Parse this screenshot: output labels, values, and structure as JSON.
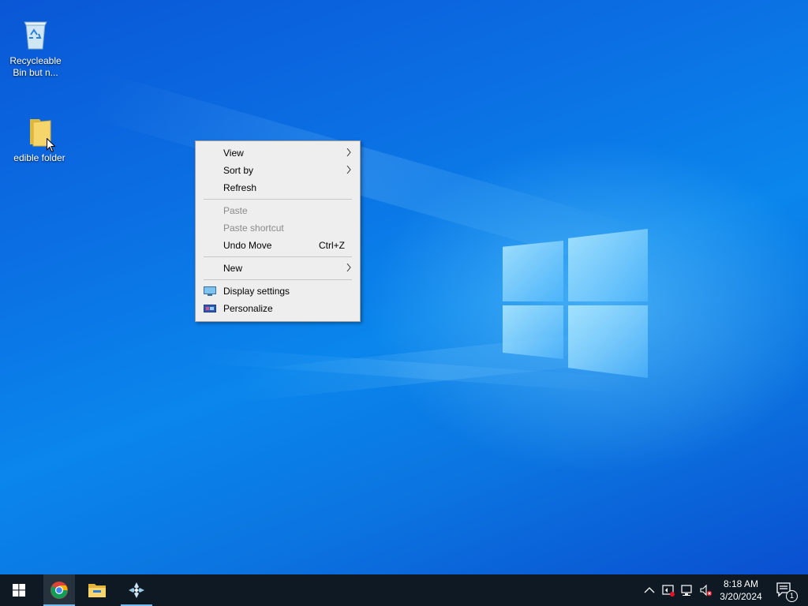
{
  "desktop": {
    "icons": [
      {
        "label": "Recycleable Bin but n...",
        "icon": "recycle-bin-icon"
      },
      {
        "label": "edible folder",
        "icon": "folder-icon"
      }
    ]
  },
  "context_menu": {
    "items": [
      {
        "label": "View",
        "has_submenu": true,
        "enabled": true
      },
      {
        "label": "Sort by",
        "has_submenu": true,
        "enabled": true
      },
      {
        "label": "Refresh",
        "enabled": true
      },
      {
        "label": "Paste",
        "enabled": false
      },
      {
        "label": "Paste shortcut",
        "enabled": false
      },
      {
        "label": "Undo Move",
        "shortcut": "Ctrl+Z",
        "enabled": true
      },
      {
        "label": "New",
        "has_submenu": true,
        "enabled": true
      },
      {
        "label": "Display settings",
        "icon": "display-settings-icon",
        "enabled": true
      },
      {
        "label": "Personalize",
        "icon": "personalize-icon",
        "enabled": true
      }
    ]
  },
  "taskbar": {
    "start_icon": "windows-start-icon",
    "pinned": [
      {
        "name": "Google Chrome",
        "icon": "chrome-icon",
        "active": true
      },
      {
        "name": "File Explorer",
        "icon": "file-explorer-icon",
        "active": false
      },
      {
        "name": "App",
        "icon": "app-icon",
        "active": true
      }
    ],
    "tray": {
      "icons": [
        "chevron-up-icon",
        "security-icon",
        "network-icon",
        "volume-muted-icon"
      ],
      "time": "8:18 AM",
      "date": "3/20/2024",
      "notification_count": "1"
    }
  },
  "colors": {
    "taskbar_bg": "#0f1923",
    "menu_bg": "#eeeeee",
    "accent": "#76b9ed"
  }
}
